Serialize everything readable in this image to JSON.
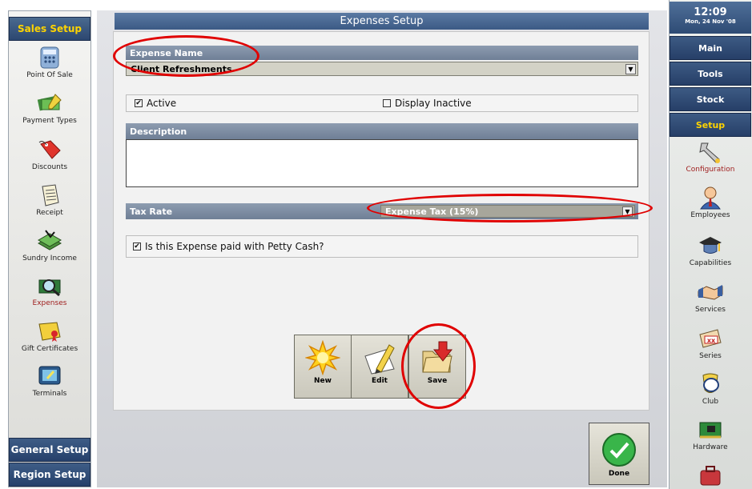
{
  "main": {
    "title": "Expenses Setup",
    "expense_name_header": "Expense Name",
    "expense_name_value": "Client Refreshments",
    "active_label": "Active",
    "active_checked": true,
    "display_inactive_label": "Display Inactive",
    "display_inactive_checked": false,
    "description_header": "Description",
    "description_value": "",
    "tax_rate_header": "Tax Rate",
    "tax_rate_value": "Expense Tax (15%)",
    "petty_cash_label": "Is this Expense paid with Petty Cash?",
    "petty_cash_checked": true,
    "buttons": {
      "new": "New",
      "edit": "Edit",
      "save": "Save"
    },
    "done_label": "Done"
  },
  "left_sidebar": {
    "top_tab": "Sales Setup",
    "items": [
      {
        "label": "Point Of Sale",
        "icon": "calculator-icon"
      },
      {
        "label": "Payment Types",
        "icon": "money-icon"
      },
      {
        "label": "Discounts",
        "icon": "price-tag-icon"
      },
      {
        "label": "Receipt",
        "icon": "receipt-icon"
      },
      {
        "label": "Sundry Income",
        "icon": "cash-stack-icon"
      },
      {
        "label": "Expenses",
        "icon": "magnifier-money-icon",
        "active": true
      },
      {
        "label": "Gift Certificates",
        "icon": "certificate-icon"
      },
      {
        "label": "Terminals",
        "icon": "terminal-icon"
      }
    ],
    "bottom_buttons": [
      "General Setup",
      "Region Setup"
    ]
  },
  "right_sidebar": {
    "time": "12:09",
    "date": "Mon, 24 Nov '08",
    "nav": [
      "Main",
      "Tools",
      "Stock",
      "Setup"
    ],
    "active_nav": "Setup",
    "items": [
      {
        "label": "Configuration",
        "icon": "wrench-icon",
        "active": true
      },
      {
        "label": "Employees",
        "icon": "person-icon"
      },
      {
        "label": "Capabilities",
        "icon": "mortarboard-icon"
      },
      {
        "label": "Services",
        "icon": "handshake-icon"
      },
      {
        "label": "Series",
        "icon": "ticket-icon"
      },
      {
        "label": "Club",
        "icon": "badge-icon"
      },
      {
        "label": "Hardware",
        "icon": "circuit-card-icon"
      }
    ]
  },
  "colors": {
    "nav_blue": "#2c4770",
    "active_tab_text": "#ffd400",
    "highlight_red": "#e00000",
    "active_label": "#9e1b1b"
  }
}
